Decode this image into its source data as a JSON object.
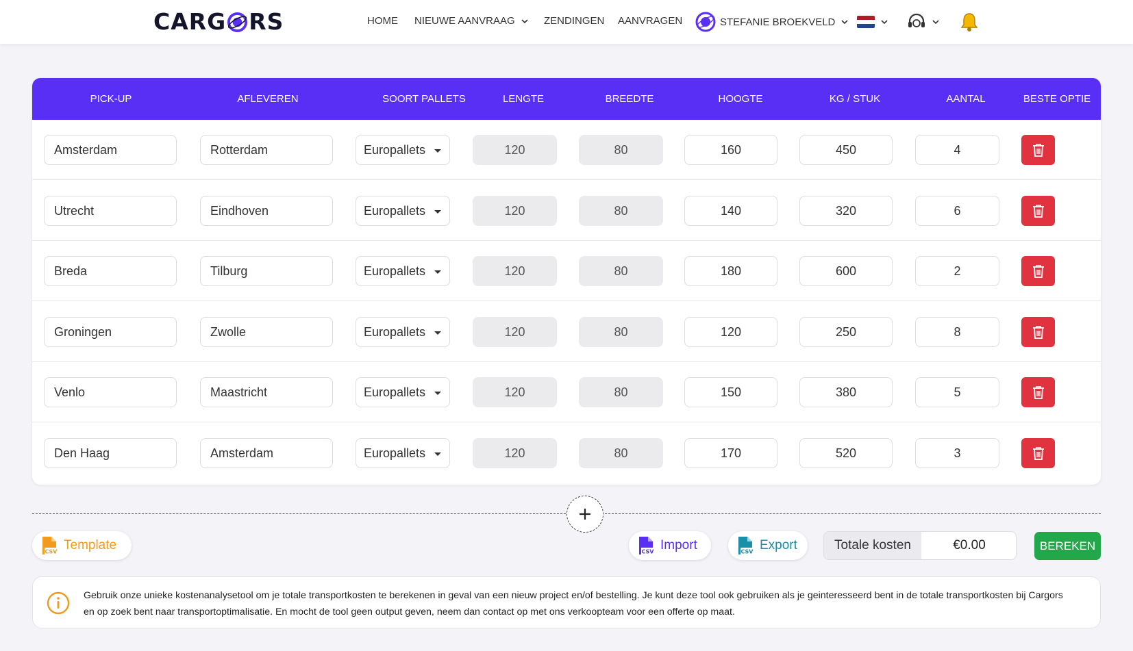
{
  "brand": {
    "logo_left": "CARG",
    "logo_right": "RS",
    "accent": "#5a2ff5",
    "delete_color": "#e0323f",
    "calc_color": "#22a84a",
    "csv_orange": "#f39a1e",
    "csv_blue": "#1a8fa8"
  },
  "nav": {
    "home": "HOME",
    "new_request": "NIEUWE AANVRAAG",
    "shipments": "ZENDINGEN",
    "requests": "AANVRAGEN",
    "user": "STEFANIE BROEKVELD"
  },
  "table": {
    "headers": [
      "PICK-UP",
      "AFLEVEREN",
      "SOORT PALLETS",
      "LENGTE",
      "BREEDTE",
      "HOOGTE",
      "KG / STUK",
      "AANTAL",
      "BESTE OPTIE"
    ],
    "rows": [
      {
        "pickup": "Amsterdam",
        "deliver": "Rotterdam",
        "pallet": "Europallets",
        "length": "120",
        "width": "80",
        "height": "160",
        "kg": "450",
        "qty": "4"
      },
      {
        "pickup": "Utrecht",
        "deliver": "Eindhoven",
        "pallet": "Europallets",
        "length": "120",
        "width": "80",
        "height": "140",
        "kg": "320",
        "qty": "6"
      },
      {
        "pickup": "Breda",
        "deliver": "Tilburg",
        "pallet": "Europallets",
        "length": "120",
        "width": "80",
        "height": "180",
        "kg": "600",
        "qty": "2"
      },
      {
        "pickup": "Groningen",
        "deliver": "Zwolle",
        "pallet": "Europallets",
        "length": "120",
        "width": "80",
        "height": "120",
        "kg": "250",
        "qty": "8"
      },
      {
        "pickup": "Venlo",
        "deliver": "Maastricht",
        "pallet": "Europallets",
        "length": "120",
        "width": "80",
        "height": "150",
        "kg": "380",
        "qty": "5"
      },
      {
        "pickup": "Den Haag",
        "deliver": "Amsterdam",
        "pallet": "Europallets",
        "length": "120",
        "width": "80",
        "height": "170",
        "kg": "520",
        "qty": "3"
      }
    ]
  },
  "actions": {
    "template": "Template",
    "import": "Import",
    "export": "Export",
    "total_label": "Totale kosten",
    "total_value": "€0.00",
    "calculate": "BEREKEN",
    "csv_badge": "CSV"
  },
  "info": {
    "text": "Gebruik onze unieke kostenanalysetool om je totale transportkosten te berekenen in geval van een nieuw project en/of bestelling. Je kunt deze tool ook gebruiken als je geinteresseerd bent in de totale transportkosten bij Cargors en op zoek bent naar transportoptimalisatie. En mocht de tool geen output geven, neem dan contact op met ons verkoopteam voor een offerte op maat."
  }
}
